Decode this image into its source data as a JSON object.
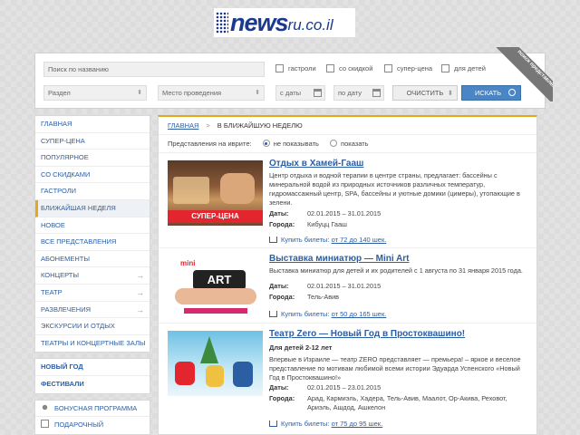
{
  "logo": {
    "text_main": "news",
    "text_suffix": "ru.co.il"
  },
  "search": {
    "name_placeholder": "Поиск по названию",
    "section_label": "Раздел",
    "venue_label": "Место проведения",
    "date_from": "с даты",
    "date_to": "по дату",
    "clear_label": "ОЧИСТИТЬ",
    "find_label": "ИСКАТЬ",
    "checks": [
      "гастроли",
      "со скидкой",
      "супер-цена",
      "для детей"
    ],
    "corner_ribbon": "поиск представлений"
  },
  "sidebar": {
    "group1": [
      {
        "label": "Главная"
      },
      {
        "label": "Супер-цена"
      },
      {
        "label": "Популярное"
      },
      {
        "label": "Со скидками"
      },
      {
        "label": "Гастроли"
      },
      {
        "label": "Ближайшая неделя"
      },
      {
        "label": "Новое"
      },
      {
        "label": "Все представления"
      },
      {
        "label": "Абонементы"
      },
      {
        "label": "Концерты"
      },
      {
        "label": "Театр"
      },
      {
        "label": "Развлечения"
      },
      {
        "label": "Экскурсии и отдых"
      },
      {
        "label": "Театры и концертные залы"
      }
    ],
    "group2": [
      {
        "label": "Новый год"
      },
      {
        "label": "Фестивали"
      }
    ],
    "group3": [
      {
        "label": "Бонусная программа"
      },
      {
        "label": "Подарочный сертификат"
      }
    ]
  },
  "breadcrumb": {
    "home": "ГЛАВНАЯ",
    "current": "В БЛИЖАЙШУЮ НЕДЕЛЮ"
  },
  "hebrew_filter": {
    "label": "Представления на иврите:",
    "opt1": "не показывать",
    "opt2": "показать"
  },
  "events": [
    {
      "title": "Отдых в Хамей-Гааш",
      "desc": "Центр отдыха и водной терапии в центре страны, предлагает: бассейны с минеральной водой из природных источников различных температур, гидромассажный центр, SPA, бассейны и уютные домики (цимеры), утопающие в зелени.",
      "dates_label": "Даты:",
      "dates": "02.01.2015 – 31.01.2015",
      "city_label": "Города:",
      "city": "Кибуцц Гааш",
      "buy": "Купить билеты:",
      "price": "от 72 до 140 шек.",
      "badge": "СУПЕР-ЦЕНА"
    },
    {
      "title": "Выставка миниатюр — Mini Art",
      "desc": "Выставка миниатюр для детей и их родителей с 1 августа по 31 января 2015 года.",
      "dates_label": "Даты:",
      "dates": "02.01.2015 – 31.01.2015",
      "city_label": "Города:",
      "city": "Тель-Авив",
      "buy": "Купить билеты:",
      "price": "от 50 до 165 шек.",
      "thumb_text": "mini ART"
    },
    {
      "title": "Театр Zero — Новый Год в Простоквашино!",
      "sub": "Для детей 2-12 лет",
      "desc": "Впервые в Израиле — театр ZERO представляет — премьера! – яркое и веселое представление по мотивам любимой всеми истории Эдуарда Успенского «Новый Год в Простоквашино!»",
      "dates_label": "Даты:",
      "dates": "02.01.2015 – 23.01.2015",
      "city_label": "Города:",
      "city": "Арад, Кармиэль, Хадера, Тель-Авив, Маалот, Ор-Акива, Реховот, Ариэль, Ашдод, Ашкелон",
      "buy": "Купить билеты:",
      "price": "от 75 до 95 шек."
    }
  ],
  "colors": {
    "accent": "#e6a817",
    "link": "#2b5ea3",
    "button": "#4a86c5",
    "badge": "#e3262d"
  }
}
